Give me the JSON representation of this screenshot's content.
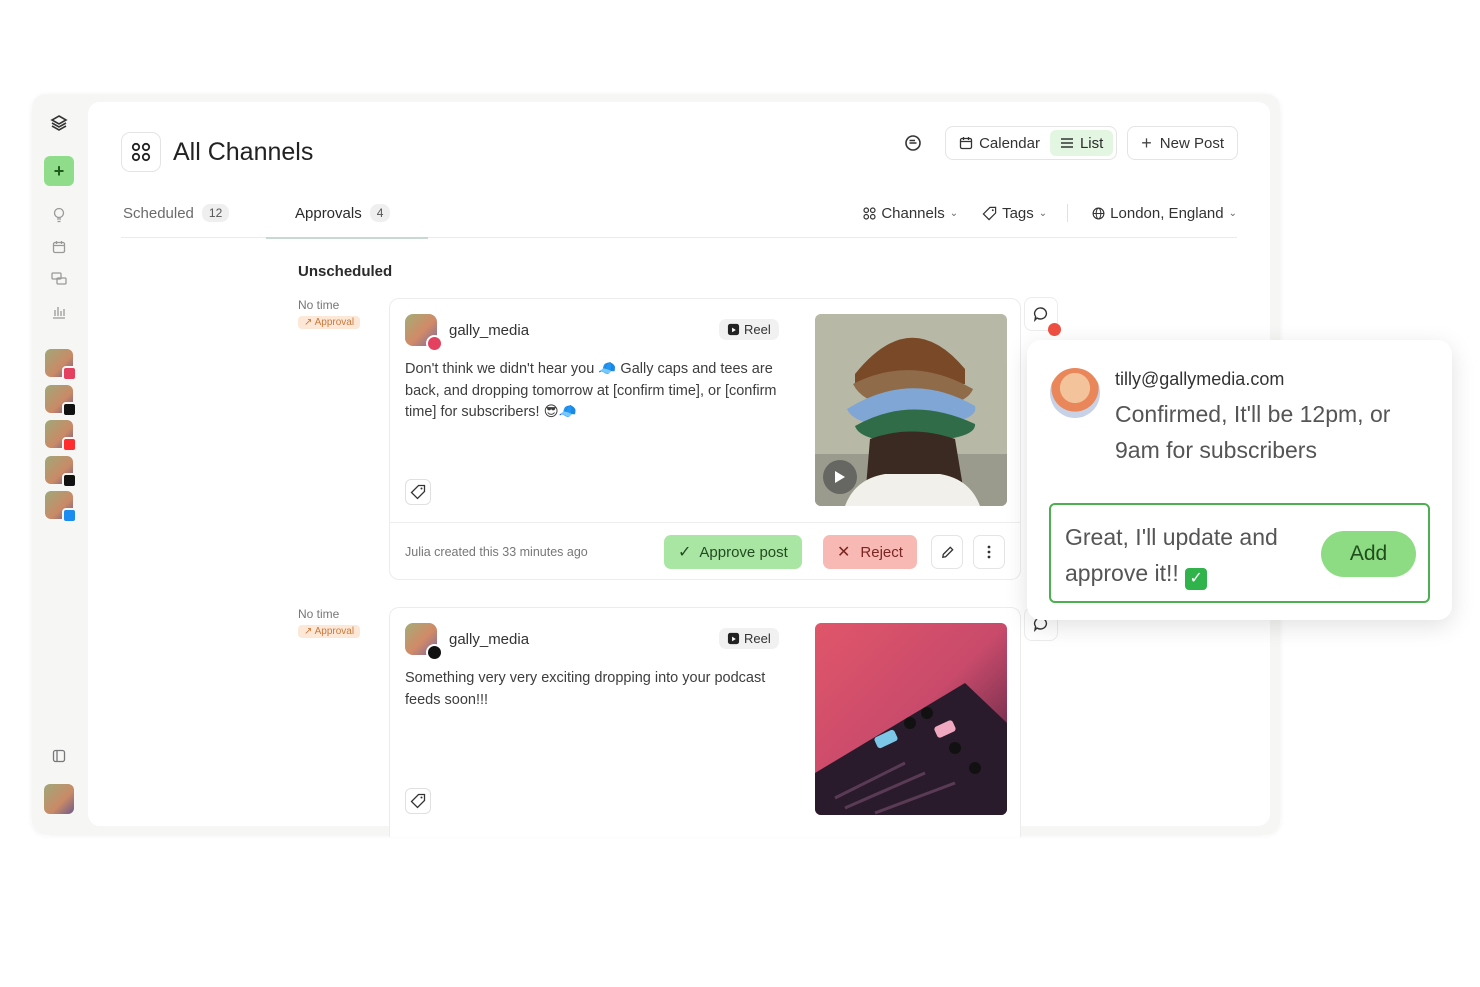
{
  "header": {
    "title": "All Channels",
    "view_calendar": "Calendar",
    "view_list": "List",
    "new_post": "New Post"
  },
  "tabs": [
    {
      "label": "Scheduled",
      "count": "12"
    },
    {
      "label": "Approvals",
      "count": "4"
    }
  ],
  "filters": {
    "channels": "Channels",
    "tags": "Tags",
    "location": "London, England"
  },
  "section_title": "Unscheduled",
  "posts": [
    {
      "time": "No time",
      "badge": "Approval",
      "username": "gally_media",
      "platform_icon": "instagram-icon",
      "platform_color": "#e4405f",
      "type": "Reel",
      "caption": "Don't think we didn't hear you 🧢 Gally caps and tees are back, and dropping tomorrow at [confirm time], or [confirm time] for subscribers! 😎🧢",
      "created": "Julia created this 33 minutes ago",
      "approve": "Approve post",
      "reject": "Reject"
    },
    {
      "time": "No time",
      "badge": "Approval",
      "username": "gally_media",
      "platform_icon": "tiktok-icon",
      "platform_color": "#111111",
      "type": "Reel",
      "caption": "Something very very exciting dropping into your podcast feeds soon!!!"
    }
  ],
  "comment": {
    "email": "tilly@gallymedia.com",
    "message": "Confirmed, It'll be 12pm, or 9am for subscribers",
    "reply_text": "Great, I'll update and approve it!!",
    "add_button": "Add"
  },
  "sidebar_channels": [
    {
      "badge_icon": "instagram-icon",
      "color": "#e4405f"
    },
    {
      "badge_icon": "tiktok-icon",
      "color": "#111111"
    },
    {
      "badge_icon": "youtube-icon",
      "color": "#ff2d2d"
    },
    {
      "badge_icon": "x-icon",
      "color": "#111111"
    },
    {
      "badge_icon": "bluesky-icon",
      "color": "#1d8cf0"
    }
  ],
  "colors": {
    "accent_green": "#8ddc84",
    "reject_red": "#f8b8b4",
    "notification_red": "#ef4f43"
  }
}
